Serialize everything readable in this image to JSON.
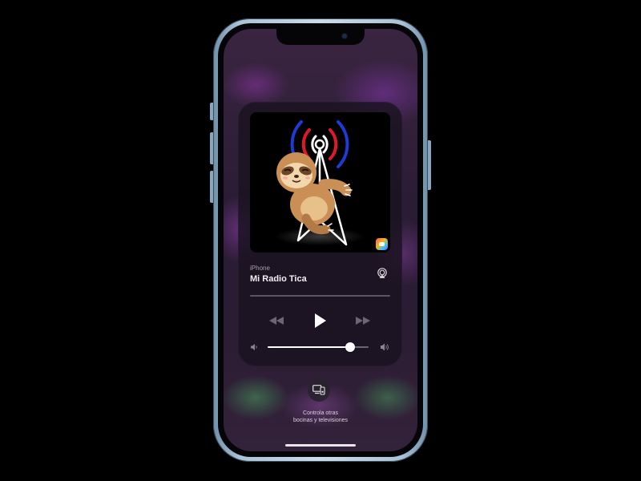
{
  "now_playing": {
    "device": "iPhone",
    "title": "Mi Radio Tica",
    "volume": 0.82,
    "progress": 0.0,
    "icons": {
      "airplay": "airplay-icon",
      "rewind": "rewind-icon",
      "play": "play-icon",
      "forward": "fast-forward-icon",
      "volume_low": "speaker-low-icon",
      "volume_high": "speaker-high-icon",
      "app_badge": "radio-app-icon"
    }
  },
  "other_devices": {
    "line1": "Controla otras",
    "line2": "bocinas y televisiones",
    "icon": "tv-speaker-icon"
  },
  "colors": {
    "radio_wave_blue": "#1f3bd6",
    "radio_wave_red": "#e0192a",
    "background": "#2b1c36",
    "phone_frame": "#a9c3d8"
  }
}
